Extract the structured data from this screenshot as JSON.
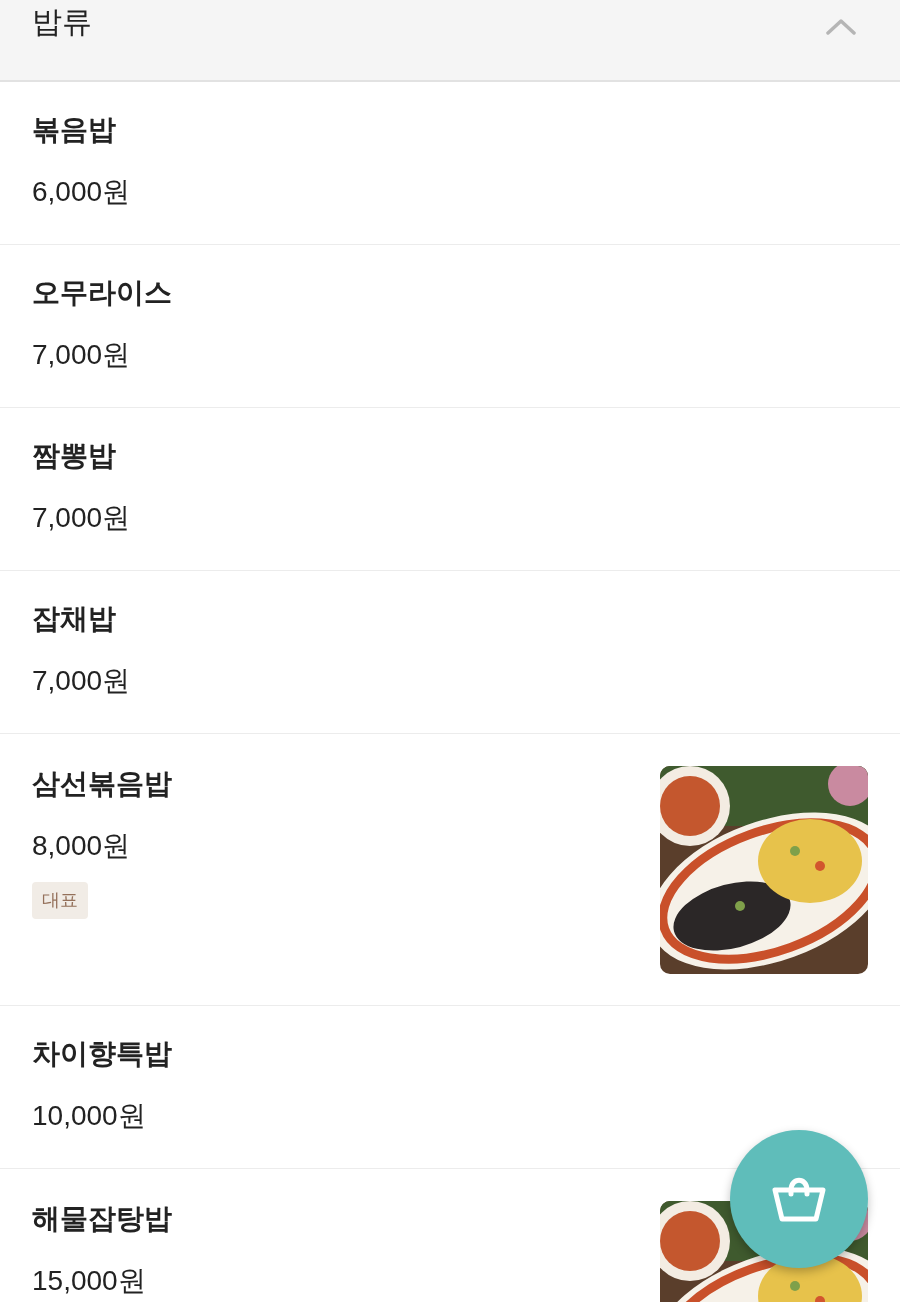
{
  "category": {
    "title": "밥류",
    "expanded": true
  },
  "items": [
    {
      "name": "볶음밥",
      "price": "6,000원"
    },
    {
      "name": "오무라이스",
      "price": "7,000원"
    },
    {
      "name": "짬뽕밥",
      "price": "7,000원"
    },
    {
      "name": "잡채밥",
      "price": "7,000원"
    },
    {
      "name": "삼선볶음밥",
      "price": "8,000원",
      "badges": [
        "대표"
      ]
    },
    {
      "name": "차이향특밥",
      "price": "10,000원"
    },
    {
      "name": "해물잡탕밥",
      "price": "15,000원"
    }
  ]
}
